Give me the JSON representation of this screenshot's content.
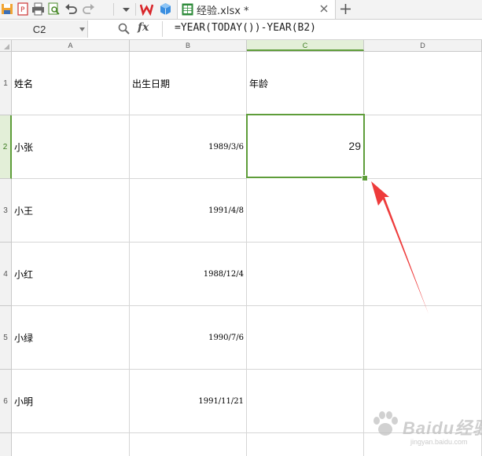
{
  "toolbar": {
    "icons": [
      "save-icon",
      "export-pdf-icon",
      "print-icon",
      "print-preview-icon",
      "undo-icon",
      "redo-icon",
      "customize-dropdown-icon",
      "wps-logo-icon",
      "app-center-icon"
    ]
  },
  "file_tab": {
    "name": "经验.xlsx *"
  },
  "formula_bar": {
    "name_box": "C2",
    "fx_label": "fx",
    "formula": "=YEAR(TODAY())-YEAR(B2)"
  },
  "sheet": {
    "columns": [
      "A",
      "B",
      "C",
      "D"
    ],
    "active_column": "C",
    "rows": [
      {
        "num": "1",
        "cells": [
          "姓名",
          "出生日期",
          "年龄",
          ""
        ]
      },
      {
        "num": "2",
        "cells": [
          "小张",
          "1989/3/6",
          "29",
          ""
        ]
      },
      {
        "num": "3",
        "cells": [
          "小王",
          "1991/4/8",
          "",
          ""
        ]
      },
      {
        "num": "4",
        "cells": [
          "小红",
          "1988/12/4",
          "",
          ""
        ]
      },
      {
        "num": "5",
        "cells": [
          "小绿",
          "1990/7/6",
          "",
          ""
        ]
      },
      {
        "num": "6",
        "cells": [
          "小明",
          "1991/11/21",
          "",
          ""
        ]
      }
    ],
    "active_row": "2",
    "selected_cell": "C2"
  },
  "annotation": {
    "arrow_color": "#ee3b3b"
  },
  "watermark": {
    "text": "Baidu经验",
    "sub": "jingyan.baidu.com"
  },
  "colors": {
    "accent_green": "#5e9d3a",
    "header_bg": "#f2f2f2",
    "grid_line": "#d6d6d6"
  }
}
